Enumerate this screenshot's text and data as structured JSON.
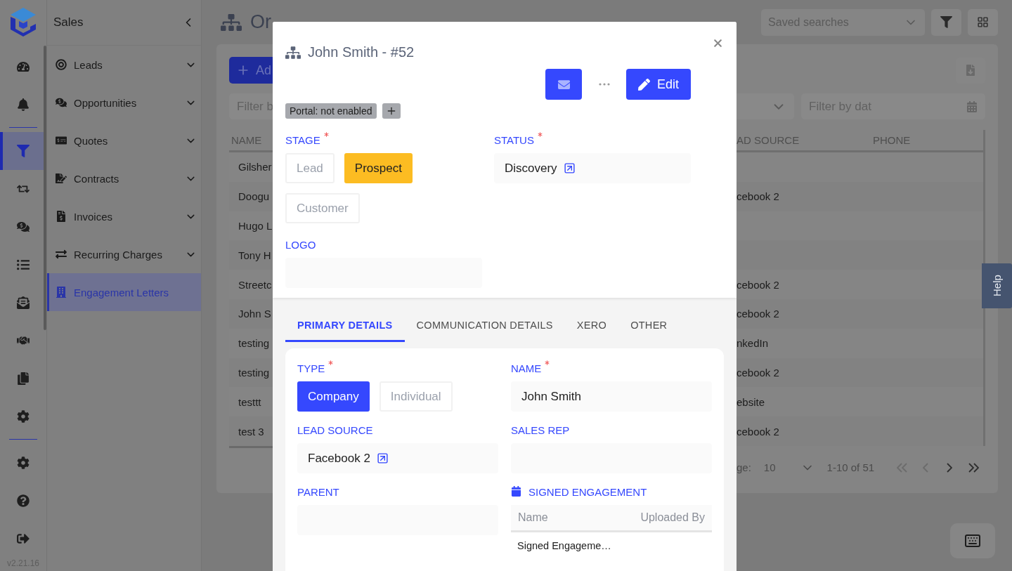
{
  "rail": {
    "groups": [
      [
        {
          "selected": false
        },
        {
          "selected": false
        }
      ],
      [
        {
          "selected": true
        },
        {
          "selected": false
        },
        {
          "selected": false
        },
        {
          "selected": false
        },
        {
          "selected": false
        },
        {
          "selected": false
        },
        {
          "selected": false
        },
        {
          "selected": false
        }
      ],
      [
        {
          "selected": false
        },
        {
          "selected": false
        },
        {
          "selected": false
        }
      ]
    ],
    "version": "v2.21.16"
  },
  "sidebar": {
    "title": "Sales",
    "items": [
      {
        "label": "Leads",
        "expandable": true,
        "selected": false
      },
      {
        "label": "Opportunities",
        "expandable": true,
        "selected": false
      },
      {
        "label": "Quotes",
        "expandable": true,
        "selected": false
      },
      {
        "label": "Contracts",
        "expandable": true,
        "selected": false
      },
      {
        "label": "Invoices",
        "expandable": true,
        "selected": false
      },
      {
        "label": "Recurring Charges",
        "expandable": true,
        "selected": false
      },
      {
        "label": "Engagement Letters",
        "expandable": false,
        "selected": true
      }
    ]
  },
  "page": {
    "title": "Or",
    "saved_searches": {
      "placeholder": "Saved searches"
    },
    "add_button": "Ad",
    "filters": [
      {
        "placeholder": "Filter b"
      },
      {
        "placeholder": "Filter by dat"
      }
    ],
    "table": {
      "columns": [
        "NAME",
        "AD SOURCE",
        "PHONE"
      ],
      "rows": [
        {
          "name": "Gilsher",
          "lead_source": ""
        },
        {
          "name": "Doogu",
          "lead_source": "cebook 2"
        },
        {
          "name": "Hugo L",
          "lead_source": ""
        },
        {
          "name": "Tony H",
          "lead_source": ""
        },
        {
          "name": "Streetc",
          "lead_source": "cebook 2"
        },
        {
          "name": "John S",
          "lead_source": "cebook 2"
        },
        {
          "name": "testing",
          "lead_source": "nkedIn"
        },
        {
          "name": "testing",
          "lead_source": "cebook 2"
        },
        {
          "name": "testtt",
          "lead_source": "ebsite"
        },
        {
          "name": "test 3",
          "lead_source": "cebook 2"
        }
      ]
    },
    "pagination": {
      "per_page_label": "ge:",
      "per_page": "10",
      "range": "1-10 of 51",
      "pager": [
        {
          "disabled": true
        },
        {
          "disabled": true
        },
        {
          "disabled": false
        },
        {
          "disabled": false
        }
      ]
    }
  },
  "help_tab": "Help",
  "modal": {
    "title": "John Smith - #52",
    "edit_label": "Edit",
    "tags": [
      "Portal: not enabled"
    ],
    "header_fields": [
      {
        "kind": "stage",
        "label": "STAGE",
        "required": true,
        "options": [
          {
            "label": "Lead",
            "selected": false
          },
          {
            "label": "Prospect",
            "selected": true
          },
          {
            "label": "Customer",
            "selected": false
          }
        ]
      },
      {
        "kind": "link",
        "label": "STATUS",
        "required": true,
        "value": "Discovery"
      },
      {
        "kind": "text",
        "label": "LOGO"
      }
    ],
    "tabs": [
      {
        "label": "PRIMARY DETAILS",
        "selected": true
      },
      {
        "label": "COMMUNICATION DETAILS",
        "selected": false
      },
      {
        "label": "XERO",
        "selected": false
      },
      {
        "label": "OTHER",
        "selected": false
      }
    ],
    "detail_fields": [
      {
        "kind": "choice",
        "label": "TYPE",
        "required": true,
        "options": [
          {
            "label": "Company",
            "selected": true
          },
          {
            "label": "Individual",
            "selected": false
          }
        ]
      },
      {
        "kind": "text",
        "label": "NAME",
        "required": true,
        "value": "John Smith"
      },
      {
        "kind": "link",
        "label": "LEAD SOURCE",
        "value": "Facebook 2"
      },
      {
        "kind": "text",
        "label": "SALES REP"
      },
      {
        "kind": "text",
        "label": "PARENT"
      },
      {
        "kind": "files",
        "label": "SIGNED ENGAGEMENT",
        "columns": [
          "Name",
          "Uploaded By"
        ],
        "rows": [
          "Signed Engageme…"
        ]
      }
    ]
  }
}
